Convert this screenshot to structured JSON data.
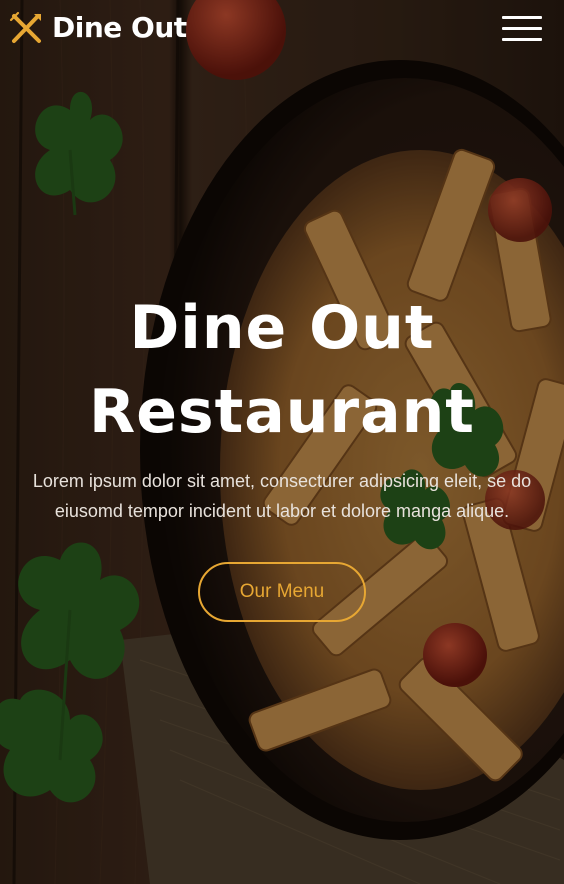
{
  "brand": {
    "name": "Dine Out",
    "icon": "fork-knife-icon",
    "accent_color": "#e7a733"
  },
  "nav": {
    "menu_icon": "hamburger-menu-icon"
  },
  "hero": {
    "title_line1": "Dine Out",
    "title_line2": "Restaurant",
    "description": "Lorem ipsum dolor sit amet, consecturer adipsicing eleit, se do eiusomd tempor incident ut labor et dolore manga alique.",
    "cta_label": "Our Menu"
  }
}
